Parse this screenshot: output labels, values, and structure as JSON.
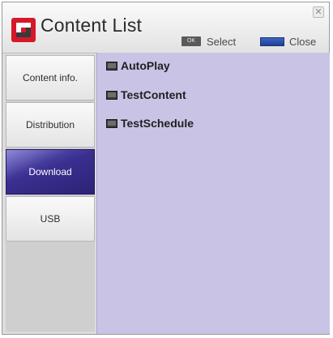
{
  "window": {
    "title": "Content List",
    "close_symbol": "✕"
  },
  "hints": {
    "ok_key": "OK",
    "select_label": "Select",
    "close_label": "Close"
  },
  "sidebar": {
    "tabs": [
      {
        "label": "Content info.",
        "active": false
      },
      {
        "label": "Distribution",
        "active": false
      },
      {
        "label": "Download",
        "active": true
      },
      {
        "label": "USB",
        "active": false
      }
    ]
  },
  "content": {
    "items": [
      {
        "label": "AutoPlay",
        "icon": "tv-icon"
      },
      {
        "label": "TestContent",
        "icon": "tv-icon"
      },
      {
        "label": "TestSchedule",
        "icon": "tv-icon"
      }
    ]
  },
  "colors": {
    "accent": "#3a2f8f",
    "content_bg": "#c9c3e6",
    "logo_red": "#d7182a",
    "blue_key": "#2a4fb0"
  }
}
